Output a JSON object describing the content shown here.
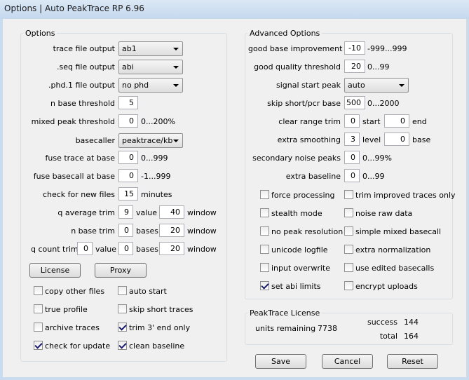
{
  "window": {
    "title": "Options | Auto PeakTrace RP 6.96"
  },
  "options": {
    "group_title": "Options",
    "trace_file_output": {
      "label": "trace file output",
      "value": "ab1"
    },
    "seq_file_output": {
      "label": ".seq file output",
      "value": "abi"
    },
    "phd_file_output": {
      "label": ".phd.1 file output",
      "value": "no phd"
    },
    "n_base_threshold": {
      "label": "n base threshold",
      "value": "5"
    },
    "mixed_peak_threshold": {
      "label": "mixed peak threshold",
      "value": "0",
      "range": "0...200%"
    },
    "basecaller": {
      "label": "basecaller",
      "value": "peaktrace/kb"
    },
    "fuse_trace_at_base": {
      "label": "fuse trace at base",
      "value": "0",
      "range": "0...999"
    },
    "fuse_basecall_at_base": {
      "label": "fuse basecall at base",
      "value": "0",
      "range": "-1...999"
    },
    "check_new_files": {
      "label": "check for new files",
      "value": "15",
      "unit": "minutes"
    },
    "q_average_trim": {
      "label": "q average trim",
      "value": "9",
      "value_label": "value",
      "window": "40",
      "window_label": "window"
    },
    "n_base_trim": {
      "label": "n base trim",
      "value": "0",
      "value_label": "bases",
      "window": "20",
      "window_label": "window"
    },
    "q_count_trim": {
      "label": "q count trim",
      "value": "0",
      "value_label": "value",
      "bases": "0",
      "bases_label": "bases",
      "window": "20",
      "window_label": "window"
    },
    "license_button": "License",
    "proxy_button": "Proxy",
    "checkboxes": {
      "copy_other_files": "copy other files",
      "auto_start": "auto start",
      "true_profile": "true profile",
      "skip_short_traces": "skip short traces",
      "archive_traces": "archive traces",
      "trim_3_end_only": "trim 3' end only",
      "check_for_update": "check for update",
      "clean_baseline": "clean baseline"
    }
  },
  "advanced": {
    "group_title": "Advanced Options",
    "good_base_improvement": {
      "label": "good base improvement",
      "value": "-10",
      "range": "-999...999"
    },
    "good_quality_threshold": {
      "label": "good quality threshold",
      "value": "20",
      "range": "0...99"
    },
    "signal_start_peak": {
      "label": "signal start peak",
      "value": "auto"
    },
    "skip_short_pcr_base": {
      "label": "skip short/pcr base",
      "value": "500",
      "range": "0...2000"
    },
    "clear_range_trim": {
      "label": "clear range trim",
      "start": "0",
      "start_label": "start",
      "end": "0",
      "end_label": "end"
    },
    "extra_smoothing": {
      "label": "extra smoothing",
      "level": "3",
      "level_label": "level",
      "base": "0",
      "base_label": "base"
    },
    "secondary_noise_peaks": {
      "label": "secondary noise peaks",
      "value": "0",
      "range": "0...99%"
    },
    "extra_baseline": {
      "label": "extra baseline",
      "value": "0",
      "range": "0...99"
    },
    "checkboxes": {
      "force_processing": "force processing",
      "trim_improved_traces_only": "trim improved traces only",
      "stealth_mode": "stealth mode",
      "noise_raw_data": "noise raw data",
      "no_peak_resolution": "no peak resolution",
      "simple_mixed_basecall": "simple mixed basecall",
      "unicode_logfile": "unicode logfile",
      "extra_normalization": "extra normalization",
      "input_overwrite": "input overwrite",
      "use_edited_basecalls": "use edited basecalls",
      "set_abi_limits": "set abi limits",
      "encrypt_uploads": "encrypt uploads"
    }
  },
  "license": {
    "group_title": "PeakTrace License",
    "units_label": "units remaining",
    "units_value": "7738",
    "success_label": "success",
    "success_value": "144",
    "total_label": "total",
    "total_value": "164"
  },
  "buttons": {
    "save": "Save",
    "cancel": "Cancel",
    "reset": "Reset"
  }
}
